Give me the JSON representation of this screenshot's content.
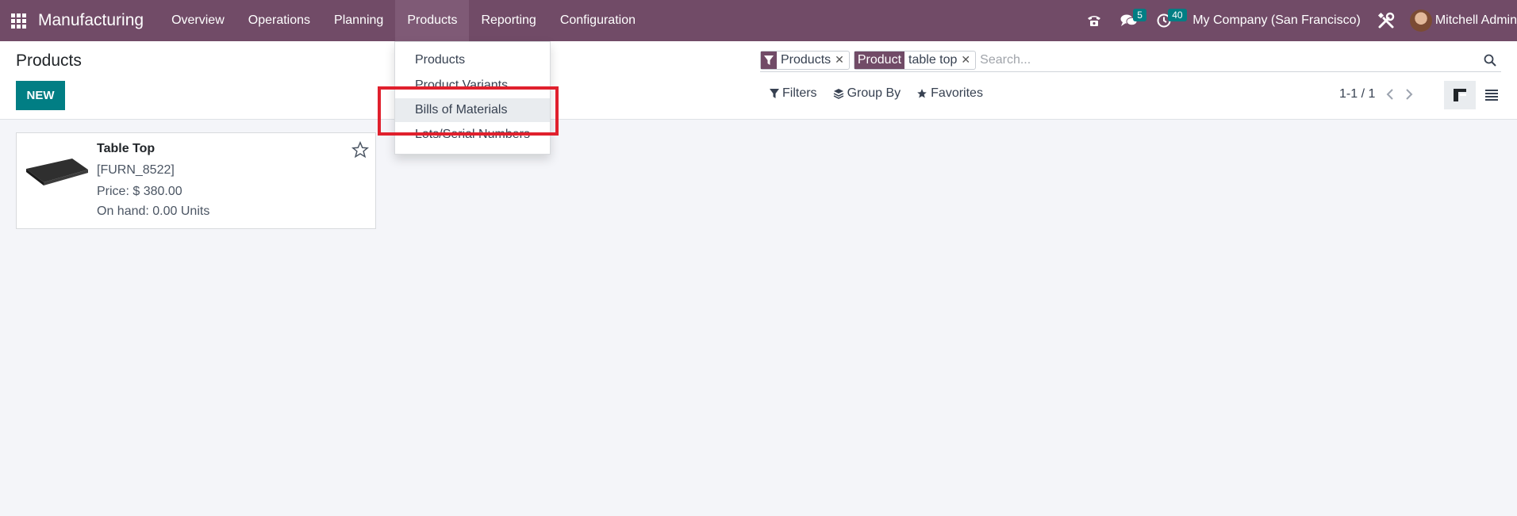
{
  "navbar": {
    "brand": "Manufacturing",
    "menu": [
      "Overview",
      "Operations",
      "Planning",
      "Products",
      "Reporting",
      "Configuration"
    ],
    "active_menu": "Products",
    "messages_count": "5",
    "activities_count": "40",
    "company": "My Company (San Francisco)",
    "user": "Mitchell Admin"
  },
  "control": {
    "title": "Products",
    "new_label": "NEW",
    "facets": [
      {
        "tag": "",
        "value": "Products",
        "icon": "filter-icon"
      },
      {
        "tag": "Product",
        "value": "table top"
      }
    ],
    "search_placeholder": "Search...",
    "filters_label": "Filters",
    "groupby_label": "Group By",
    "favorites_label": "Favorites",
    "pager": "1-1 / 1"
  },
  "dropdown": {
    "items": [
      "Products",
      "Product Variants",
      "Bills of Materials",
      "Lots/Serial Numbers"
    ],
    "hovered": "Bills of Materials"
  },
  "cards": [
    {
      "name": "Table Top",
      "ref": "[FURN_8522]",
      "price": "Price: $ 380.00",
      "onhand": "On hand: 0.00 Units"
    }
  ],
  "colors": {
    "brand": "#714b67",
    "primary": "#017e84",
    "highlight": "#e0202d"
  }
}
